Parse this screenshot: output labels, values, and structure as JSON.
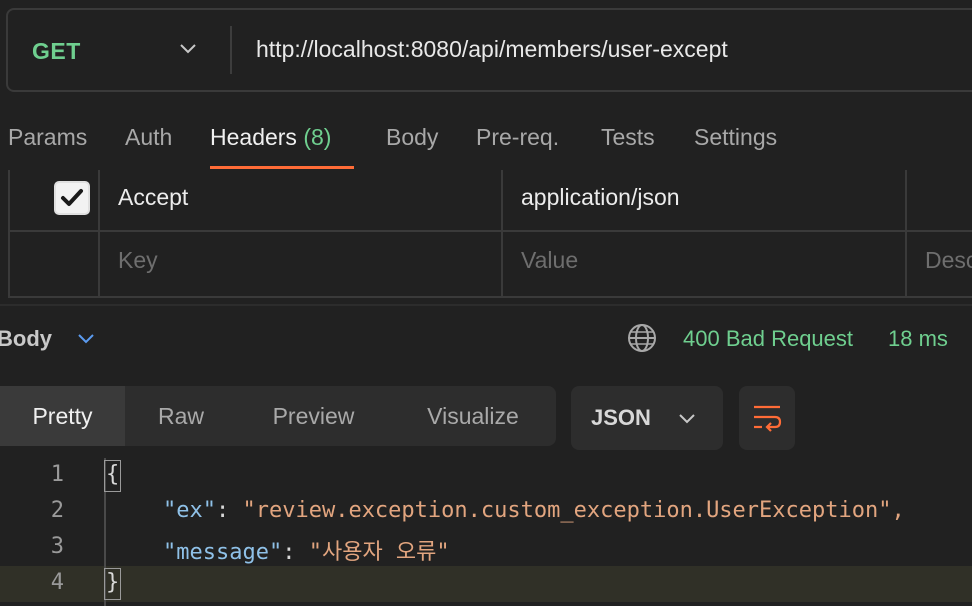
{
  "request": {
    "method": "GET",
    "url": "http://localhost:8080/api/members/user-except"
  },
  "request_tabs": [
    {
      "label": "Params"
    },
    {
      "label": "Auth"
    },
    {
      "label": "Headers",
      "count": "(8)",
      "active": true
    },
    {
      "label": "Body"
    },
    {
      "label": "Pre-req."
    },
    {
      "label": "Tests"
    },
    {
      "label": "Settings"
    }
  ],
  "headers_table": {
    "row": {
      "checked": true,
      "key": "Accept",
      "value": "application/json"
    },
    "placeholders": {
      "key": "Key",
      "value": "Value",
      "description": "Desc"
    }
  },
  "response": {
    "section_label": "Body",
    "status": "400 Bad Request",
    "time": "18 ms",
    "view_modes": [
      "Pretty",
      "Raw",
      "Preview",
      "Visualize"
    ],
    "active_view": "Pretty",
    "format": "JSON",
    "lines": [
      {
        "num": "1"
      },
      {
        "num": "2",
        "key": "\"ex\"",
        "value": "\"review.exception.custom_exception.UserException\","
      },
      {
        "num": "3",
        "key": "\"message\"",
        "value": "\"사용자 오류\""
      },
      {
        "num": "4"
      }
    ]
  },
  "colors": {
    "accent": "#ff6c37",
    "success_green": "#6fcf8f",
    "json_key": "#8fc1e8",
    "json_string": "#e2a57f"
  },
  "icons": [
    "chevron-down-icon",
    "checkbox-checked-icon",
    "globe-icon",
    "wrap-lines-icon"
  ]
}
